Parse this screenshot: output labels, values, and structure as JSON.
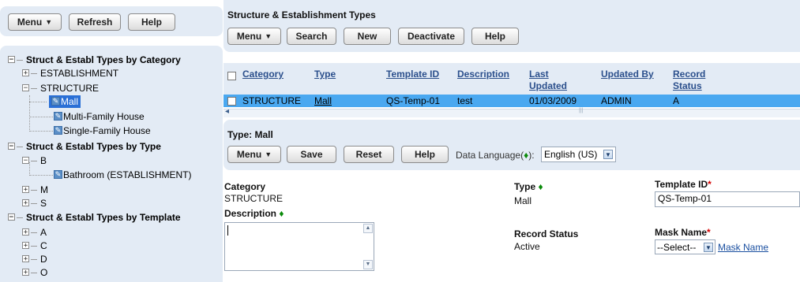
{
  "left_toolbar": {
    "menu": "Menu",
    "refresh": "Refresh",
    "help": "Help"
  },
  "tree": {
    "cat_root": "Struct & Establ Types by Category",
    "establishment": "ESTABLISHMENT",
    "structure": "STRUCTURE",
    "mall": "Mall",
    "multi_family": "Multi-Family House",
    "single_family": "Single-Family House",
    "type_root": "Struct & Establ Types by Type",
    "b": "B",
    "bathroom": "Bathroom (ESTABLISHMENT)",
    "m": "M",
    "s": "S",
    "tmpl_root": "Struct & Establ Types by Template",
    "a": "A",
    "c": "C",
    "d": "D",
    "o": "O"
  },
  "header": {
    "title": "Structure & Establishment Types",
    "menu": "Menu",
    "search": "Search",
    "new": "New",
    "deactivate": "Deactivate",
    "help": "Help"
  },
  "grid": {
    "columns": {
      "category": "Category",
      "type": "Type",
      "template_id": "Template ID",
      "description": "Description",
      "last_updated_1": "Last",
      "last_updated_2": "Updated",
      "updated_by": "Updated By",
      "record_status_1": "Record",
      "record_status_2": "Status"
    },
    "row": {
      "category": "STRUCTURE",
      "type": "Mall",
      "template_id": "QS-Temp-01",
      "description": "test",
      "last_updated": "01/03/2009",
      "updated_by": "ADMIN",
      "record_status": "A"
    }
  },
  "detail": {
    "title": "Type: Mall",
    "menu": "Menu",
    "save": "Save",
    "reset": "Reset",
    "help": "Help",
    "data_language_label": "Data Language(",
    "data_language_marker": "♦",
    "data_language_suffix": "):",
    "data_language_value": "English (US)"
  },
  "form": {
    "category_label": "Category",
    "category_value": "STRUCTURE",
    "type_label": "Type",
    "type_value": "Mall",
    "template_id_label": "Template ID",
    "template_id_value": "QS-Temp-01",
    "description_label": "Description",
    "description_value": "",
    "record_status_label": "Record Status",
    "record_status_value": "Active",
    "mask_name_label": "Mask Name",
    "mask_name_value": "--Select--",
    "mask_name_link": "Mask Name",
    "required_marker": "*",
    "mandatory_marker": "♦"
  },
  "colors": {
    "panel": "#e3ebf5",
    "selected_row": "#4aa8f0",
    "link": "#2b4f8c",
    "required": "#d40000"
  }
}
